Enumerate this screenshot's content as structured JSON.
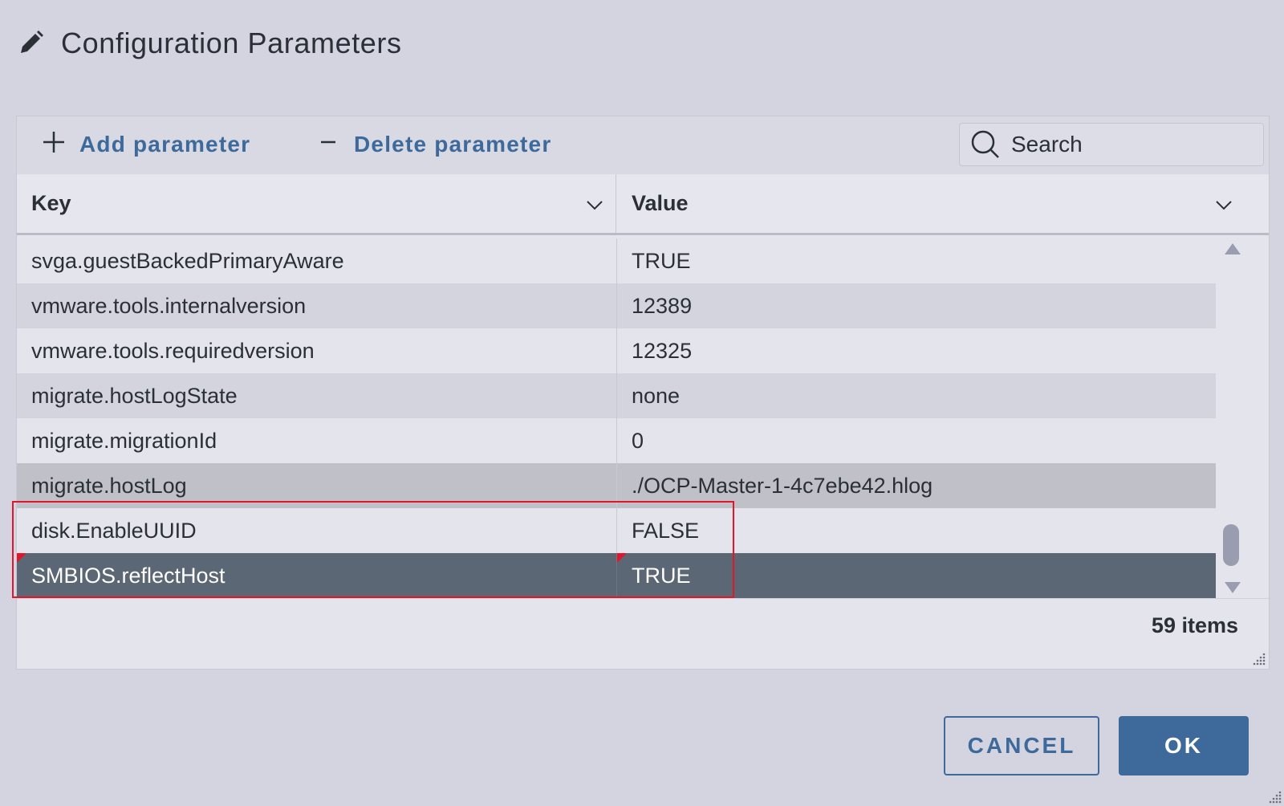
{
  "dialog": {
    "title": "Configuration Parameters",
    "icon": "pencil-icon"
  },
  "toolbar": {
    "add_icon": "plus-icon",
    "add_label": "Add parameter",
    "delete_icon": "minus-icon",
    "delete_label": "Delete parameter",
    "search_icon": "search-icon",
    "search_placeholder": "Search",
    "search_value": ""
  },
  "table": {
    "columns": [
      {
        "label": "Key",
        "icon": "chevron-down-icon"
      },
      {
        "label": "Value",
        "icon": "chevron-down-icon"
      }
    ],
    "rows": [
      {
        "key": "svga.guestBackedPrimaryAware",
        "value": "TRUE",
        "state": "normal"
      },
      {
        "key": "vmware.tools.internalversion",
        "value": "12389",
        "state": "normal"
      },
      {
        "key": "vmware.tools.requiredversion",
        "value": "12325",
        "state": "normal"
      },
      {
        "key": "migrate.hostLogState",
        "value": "none",
        "state": "normal"
      },
      {
        "key": "migrate.migrationId",
        "value": "0",
        "state": "normal"
      },
      {
        "key": "migrate.hostLog",
        "value": "./OCP-Master-1-4c7ebe42.hlog",
        "state": "hover"
      },
      {
        "key": "disk.EnableUUID",
        "value": "FALSE",
        "state": "normal"
      },
      {
        "key": "SMBIOS.reflectHost",
        "value": "TRUE",
        "state": "selected",
        "modified": true
      }
    ],
    "item_count": "59 items"
  },
  "actions": {
    "cancel_label": "CANCEL",
    "ok_label": "OK"
  },
  "colors": {
    "accent": "#3d6a9b",
    "selected_row": "#5b6775",
    "highlight": "#e2162a",
    "background": "#d3d4df"
  }
}
